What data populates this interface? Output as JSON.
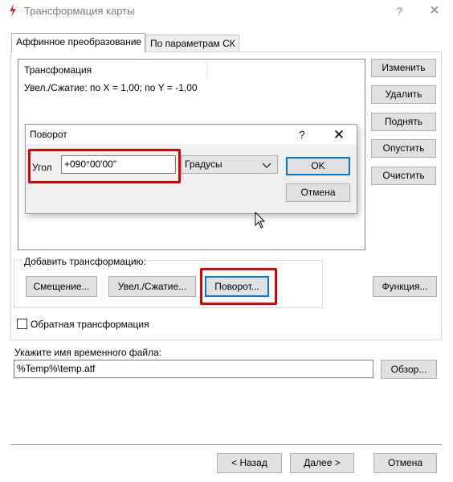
{
  "window": {
    "title": "Трансформация карты",
    "help_glyph": "?",
    "close_glyph": "✕",
    "app_icon": "red-lightning-icon"
  },
  "tabs": [
    {
      "label": "Аффинное преобразование",
      "active": true
    },
    {
      "label": "По параметрам СК",
      "active": false
    }
  ],
  "list": {
    "header": "Трансфомация",
    "items": [
      "Увел./Сжатие: по X = 1,00; по Y = -1,00"
    ]
  },
  "side_buttons": [
    "Изменить",
    "Удалить",
    "Поднять",
    "Опустить",
    "Очистить"
  ],
  "add_group": {
    "label": "Добавить трансформацию:",
    "buttons": [
      "Смещение...",
      "Увел./Сжатие...",
      "Поворот..."
    ],
    "function_button": "Функция..."
  },
  "inverse_checkbox": {
    "label": "Обратная трансформация",
    "checked": false
  },
  "temp_file": {
    "label": "Укажите имя временного файла:",
    "value": "%Temp%\\temp.atf",
    "browse_label": "Обзор..."
  },
  "footer": {
    "back": "< Назад",
    "next": "Далее >",
    "cancel": "Отмена"
  },
  "rotate_dialog": {
    "title": "Поворот",
    "help_glyph": "?",
    "close_glyph": "✕",
    "angle_label": "Угол",
    "angle_value": "+090°00'00\"",
    "unit_selected": "Градусы",
    "ok": "OK",
    "cancel": "Отмена"
  },
  "colors": {
    "highlight": "#e00000",
    "focus": "#0078d7",
    "app_icon": "#d92c2c"
  }
}
